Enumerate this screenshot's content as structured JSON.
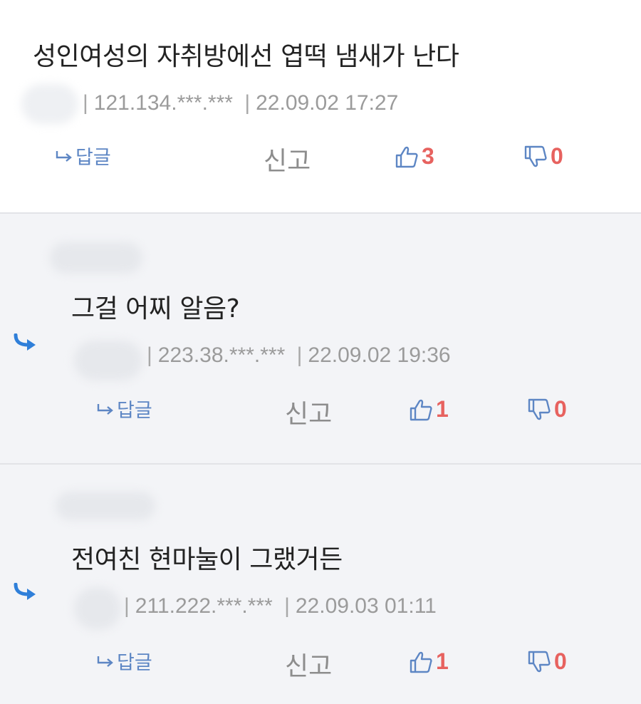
{
  "labels": {
    "reply": "답글",
    "report": "신고"
  },
  "colors": {
    "reply_blue": "#5d86c4",
    "count_red": "#e7625f",
    "reply_indicator": "#2f7fd9",
    "reply_bg": "#f3f4f7"
  },
  "comments": [
    {
      "text": "성인여성의 자취방에선 엽떡 냄새가 난다",
      "ip": "121.134.***.***",
      "date": "22.09.02 17:27",
      "up": "3",
      "down": "0",
      "is_reply": false
    },
    {
      "text": "그걸 어찌 알음?",
      "ip": "223.38.***.***",
      "date": "22.09.02 19:36",
      "up": "1",
      "down": "0",
      "is_reply": true
    },
    {
      "text": "전여친 현마눌이 그랬거든",
      "ip": "211.222.***.***",
      "date": "22.09.03 01:11",
      "up": "1",
      "down": "0",
      "is_reply": true
    }
  ]
}
